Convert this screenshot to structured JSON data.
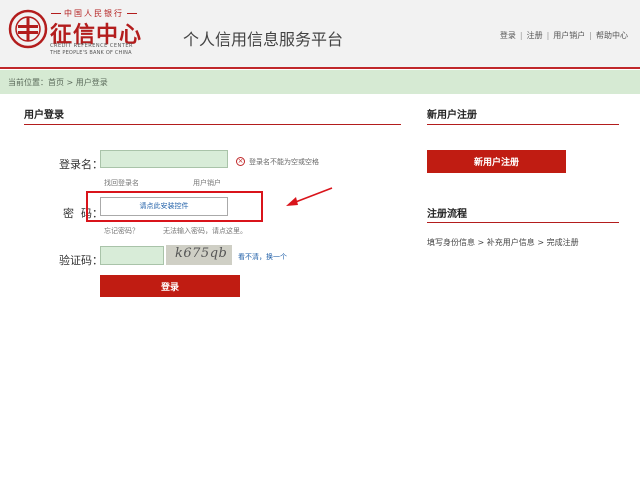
{
  "header": {
    "logo": {
      "top_text": "中国人民银行",
      "main_text": "征信中心",
      "en_line1": "CREDIT REFERENCE CENTER",
      "en_line2": "THE PEOPLE'S BANK OF CHINA"
    },
    "site_title": "个人信用信息服务平台",
    "nav": [
      "登录",
      "注册",
      "用户销户",
      "帮助中心"
    ],
    "nav_separator": "|"
  },
  "breadcrumb": {
    "prefix": "当前位置：",
    "home": "首页",
    "separator": " > ",
    "current": "用户登录"
  },
  "login": {
    "title": "用户登录",
    "username_label": "登录名：",
    "username_value": "",
    "username_error": "登录名不能为空或空格",
    "find_username": "找回登录名",
    "cancel_account": "用户销户",
    "password_label": "密  码：",
    "password_plugin": "请点此安装控件",
    "forgot_password": "忘记密码？",
    "cannot_input": "无法输入密码，请点这里。",
    "captcha_label": "验证码：",
    "captcha_value": "",
    "captcha_text": "k675qb",
    "captcha_refresh": "看不清，换一个",
    "submit": "登录"
  },
  "register": {
    "title": "新用户注册",
    "button": "新用户注册"
  },
  "process": {
    "title": "注册流程",
    "steps": "填写身份信息 > 补充用户信息 > 完成注册"
  },
  "colors": {
    "brand_red": "#c01c12",
    "breadcrumb_bg": "#d6ead3",
    "input_bg": "#d8ecd8",
    "link_blue": "#1f5fa8",
    "highlight_red": "#d9141b"
  },
  "icons": [
    "logo-seal-icon",
    "error-circle-icon",
    "arrow-annotation-icon"
  ]
}
